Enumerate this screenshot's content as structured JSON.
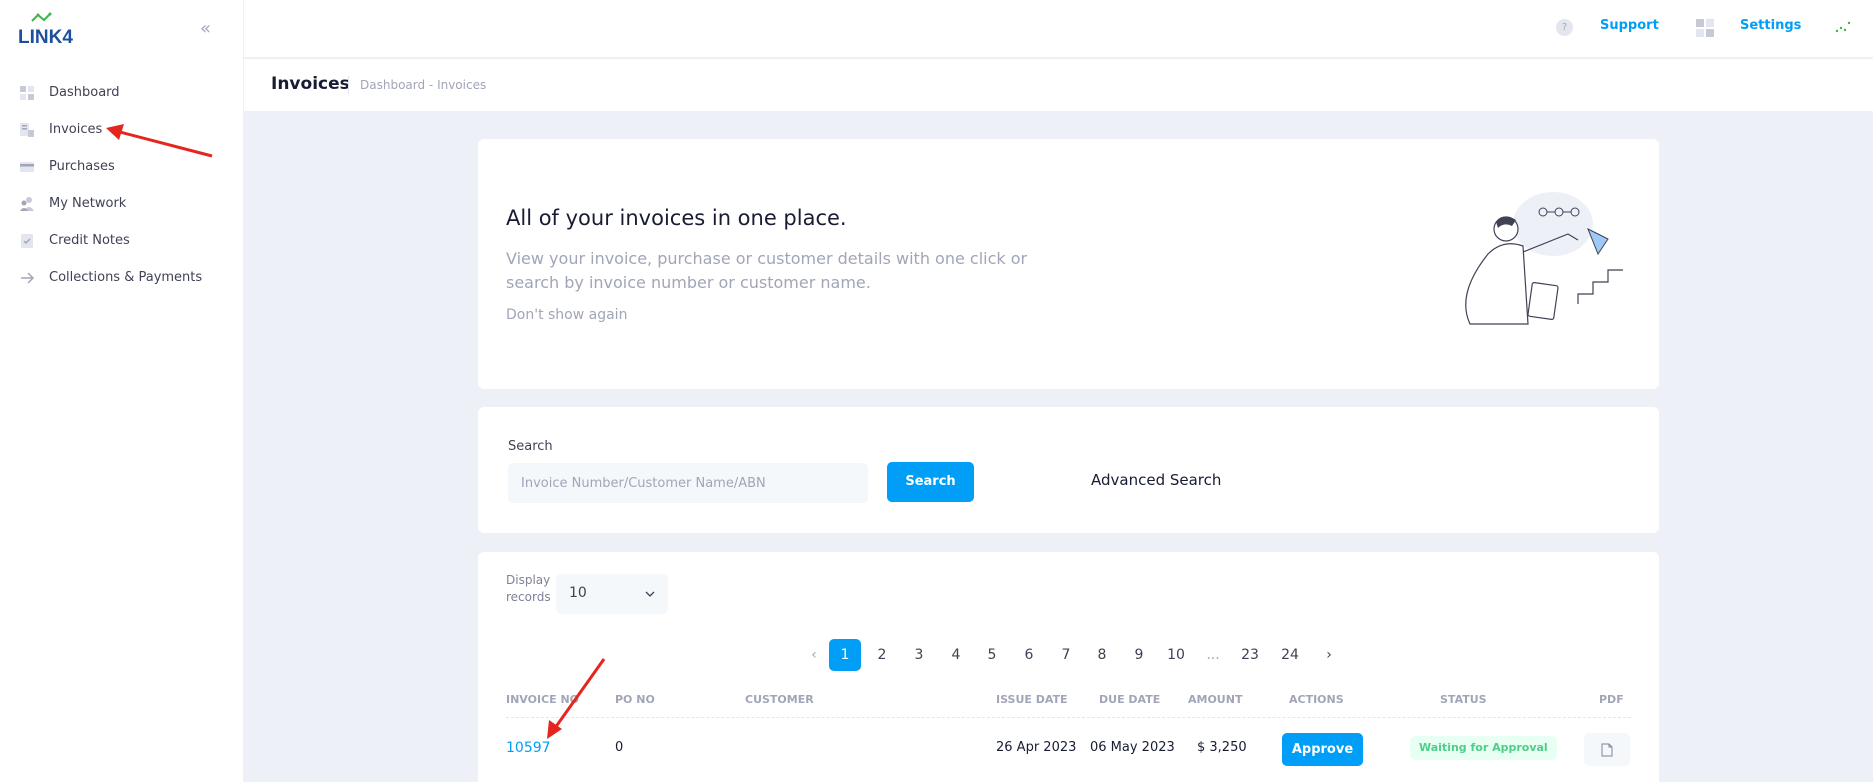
{
  "app": {
    "logo_text": "LINK4",
    "colors": {
      "primary": "#009ef7",
      "success": "#50cd89",
      "annotation_red": "#e5261f"
    }
  },
  "sidebar": {
    "collapse_icon": "double-chevron-left-icon",
    "items": [
      {
        "label": "Dashboard",
        "icon": "dashboard-icon"
      },
      {
        "label": "Invoices",
        "icon": "invoices-icon"
      },
      {
        "label": "Purchases",
        "icon": "card-icon"
      },
      {
        "label": "My Network",
        "icon": "network-icon"
      },
      {
        "label": "Credit Notes",
        "icon": "credit-note-icon"
      },
      {
        "label": "Collections & Payments",
        "icon": "arrow-right-icon"
      }
    ]
  },
  "header": {
    "support_label": "Support",
    "settings_label": "Settings",
    "help_icon_text": "?"
  },
  "subheader": {
    "title": "Invoices",
    "breadcrumb": "Dashboard - Invoices"
  },
  "hero": {
    "title": "All of your invoices in one place.",
    "description": "View your invoice, purchase or customer details with one click or search by invoice number or customer name.",
    "dismiss_label": "Don't show again"
  },
  "search": {
    "label": "Search",
    "placeholder": "Invoice Number/Customer Name/ABN",
    "value": "",
    "button_label": "Search",
    "advanced_label": "Advanced Search"
  },
  "records": {
    "display_label": "Display records",
    "selected": "10"
  },
  "pagination": {
    "prev": "‹",
    "next": "›",
    "pages": [
      "1",
      "2",
      "3",
      "4",
      "5",
      "6",
      "7",
      "8",
      "9",
      "10",
      "...",
      "23",
      "24"
    ],
    "active": "1"
  },
  "table": {
    "columns": [
      "INVOICE NO",
      "PO NO",
      "CUSTOMER",
      "ISSUE DATE",
      "DUE DATE",
      "AMOUNT",
      "ACTIONS",
      "STATUS",
      "PDF"
    ],
    "rows": [
      {
        "invoice_no": "10597",
        "po_no": "0",
        "customer": "",
        "issue_date": "26 Apr 2023",
        "due_date": "06 May 2023",
        "amount": "$ 3,250",
        "action_label": "Approve",
        "status": "Waiting for Approval",
        "pdf_icon": "file-icon"
      }
    ]
  }
}
